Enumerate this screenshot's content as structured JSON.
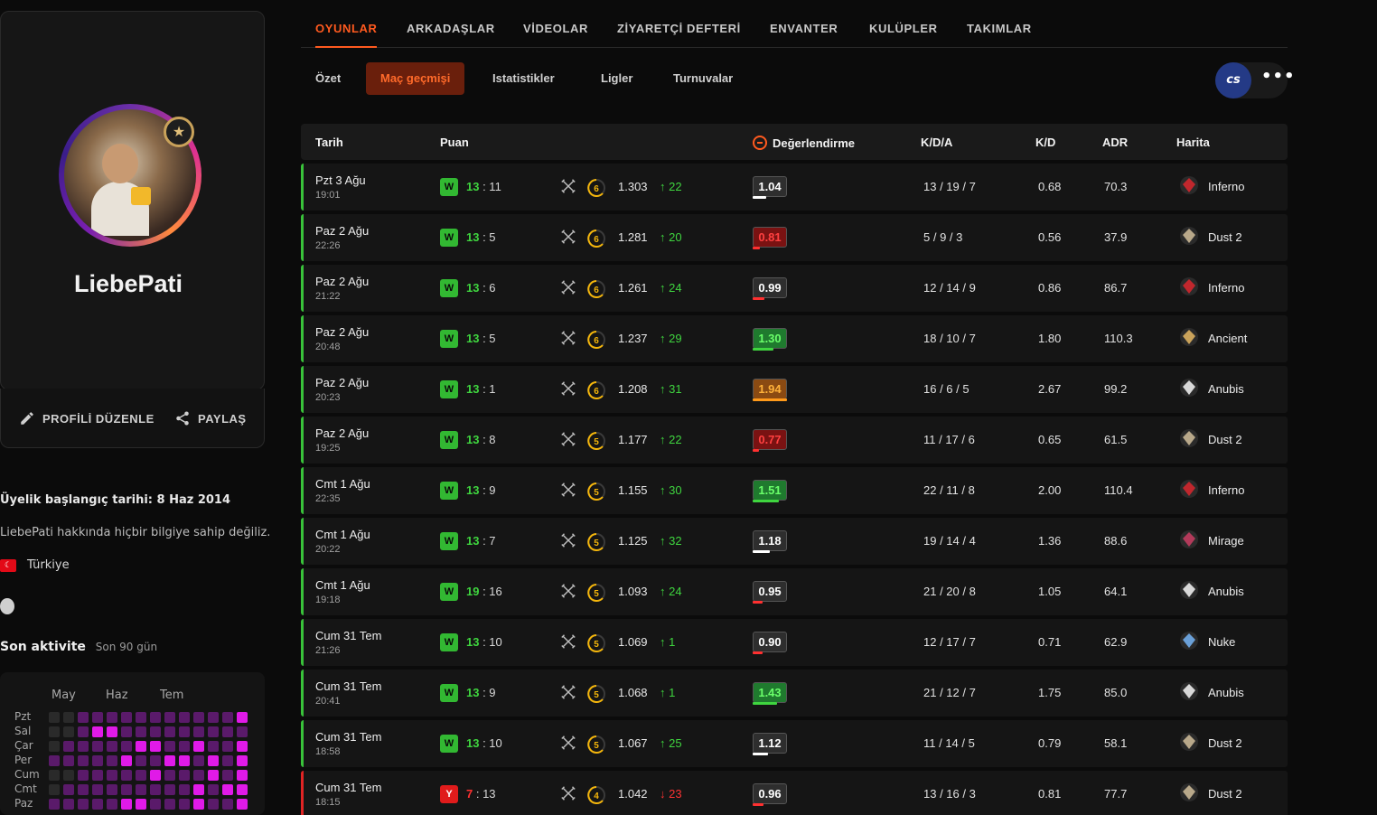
{
  "profile": {
    "username": "LiebePati",
    "edit_label": "PROFİLİ DÜZENLE",
    "share_label": "PAYLAŞ",
    "member_since": "Üyelik başlangıç tarihi: 8 Haz 2014",
    "about": "LiebePati hakkında hiçbir bilgiye sahip değiliz.",
    "country": "Türkiye",
    "activity_title": "Son aktivite",
    "activity_range": "Son 90 gün",
    "months": [
      "May",
      "Haz",
      "Tem"
    ],
    "weekdays": [
      "Pzt",
      "Sal",
      "Çar",
      "Per",
      "Cum",
      "Cmt",
      "Paz"
    ]
  },
  "nav": {
    "tabs": [
      "OYUNLAR",
      "ARKADAŞLAR",
      "VİDEOLAR",
      "ZİYARETÇİ DEFTERİ",
      "ENVANTER",
      "KULÜPLER",
      "TAKIMLAR"
    ],
    "subtabs": [
      "Özet",
      "Maç geçmişi",
      "Istatistikler",
      "Ligler",
      "Turnuvalar"
    ],
    "game_logo": "cs",
    "more_label": "•••"
  },
  "table": {
    "headers": {
      "date": "Tarih",
      "score": "Puan",
      "rating": "Değerlendirme",
      "kda": "K/D/A",
      "kd": "K/D",
      "adr": "ADR",
      "map": "Harita"
    },
    "rows": [
      {
        "date": "Pzt 3 Ağu",
        "time": "19:01",
        "result": "W",
        "my_score": "13",
        "opp_score": "11",
        "level": "6",
        "elo": "1.303",
        "delta": "22",
        "delta_dir": "up",
        "rating": "1.04",
        "rating_fill": 0.4,
        "kda": "13 / 19 / 7",
        "kd": "0.68",
        "adr": "70.3",
        "map": "Inferno"
      },
      {
        "date": "Paz 2 Ağu",
        "time": "22:26",
        "result": "W",
        "my_score": "13",
        "opp_score": "5",
        "level": "6",
        "elo": "1.281",
        "delta": "20",
        "delta_dir": "up",
        "rating": "0.81",
        "rating_fill": 0.2,
        "kda": "5 / 9 / 3",
        "kd": "0.56",
        "adr": "37.9",
        "map": "Dust 2"
      },
      {
        "date": "Paz 2 Ağu",
        "time": "21:22",
        "result": "W",
        "my_score": "13",
        "opp_score": "6",
        "level": "6",
        "elo": "1.261",
        "delta": "24",
        "delta_dir": "up",
        "rating": "0.99",
        "rating_fill": 0.35,
        "kda": "12 / 14 / 9",
        "kd": "0.86",
        "adr": "86.7",
        "map": "Inferno"
      },
      {
        "date": "Paz 2 Ağu",
        "time": "20:48",
        "result": "W",
        "my_score": "13",
        "opp_score": "5",
        "level": "6",
        "elo": "1.237",
        "delta": "29",
        "delta_dir": "up",
        "rating": "1.30",
        "rating_fill": 0.6,
        "kda": "18 / 10 / 7",
        "kd": "1.80",
        "adr": "110.3",
        "map": "Ancient"
      },
      {
        "date": "Paz 2 Ağu",
        "time": "20:23",
        "result": "W",
        "my_score": "13",
        "opp_score": "1",
        "level": "6",
        "elo": "1.208",
        "delta": "31",
        "delta_dir": "up",
        "rating": "1.94",
        "rating_fill": 1.0,
        "kda": "16 / 6 / 5",
        "kd": "2.67",
        "adr": "99.2",
        "map": "Anubis"
      },
      {
        "date": "Paz 2 Ağu",
        "time": "19:25",
        "result": "W",
        "my_score": "13",
        "opp_score": "8",
        "level": "5",
        "elo": "1.177",
        "delta": "22",
        "delta_dir": "up",
        "rating": "0.77",
        "rating_fill": 0.18,
        "kda": "11 / 17 / 6",
        "kd": "0.65",
        "adr": "61.5",
        "map": "Dust 2"
      },
      {
        "date": "Cmt 1 Ağu",
        "time": "22:35",
        "result": "W",
        "my_score": "13",
        "opp_score": "9",
        "level": "5",
        "elo": "1.155",
        "delta": "30",
        "delta_dir": "up",
        "rating": "1.51",
        "rating_fill": 0.75,
        "kda": "22 / 11 / 8",
        "kd": "2.00",
        "adr": "110.4",
        "map": "Inferno"
      },
      {
        "date": "Cmt 1 Ağu",
        "time": "20:22",
        "result": "W",
        "my_score": "13",
        "opp_score": "7",
        "level": "5",
        "elo": "1.125",
        "delta": "32",
        "delta_dir": "up",
        "rating": "1.18",
        "rating_fill": 0.5,
        "kda": "19 / 14 / 4",
        "kd": "1.36",
        "adr": "88.6",
        "map": "Mirage"
      },
      {
        "date": "Cmt 1 Ağu",
        "time": "19:18",
        "result": "W",
        "my_score": "19",
        "opp_score": "16",
        "level": "5",
        "elo": "1.093",
        "delta": "24",
        "delta_dir": "up",
        "rating": "0.95",
        "rating_fill": 0.3,
        "kda": "21 / 20 / 8",
        "kd": "1.05",
        "adr": "64.1",
        "map": "Anubis"
      },
      {
        "date": "Cum 31 Tem",
        "time": "21:26",
        "result": "W",
        "my_score": "13",
        "opp_score": "10",
        "level": "5",
        "elo": "1.069",
        "delta": "1",
        "delta_dir": "up",
        "rating": "0.90",
        "rating_fill": 0.28,
        "kda": "12 / 17 / 7",
        "kd": "0.71",
        "adr": "62.9",
        "map": "Nuke"
      },
      {
        "date": "Cum 31 Tem",
        "time": "20:41",
        "result": "W",
        "my_score": "13",
        "opp_score": "9",
        "level": "5",
        "elo": "1.068",
        "delta": "1",
        "delta_dir": "up",
        "rating": "1.43",
        "rating_fill": 0.7,
        "kda": "21 / 12 / 7",
        "kd": "1.75",
        "adr": "85.0",
        "map": "Anubis"
      },
      {
        "date": "Cum 31 Tem",
        "time": "18:58",
        "result": "W",
        "my_score": "13",
        "opp_score": "10",
        "level": "5",
        "elo": "1.067",
        "delta": "25",
        "delta_dir": "up",
        "rating": "1.12",
        "rating_fill": 0.45,
        "kda": "11 / 14 / 5",
        "kd": "0.79",
        "adr": "58.1",
        "map": "Dust 2"
      },
      {
        "date": "Cum 31 Tem",
        "time": "18:15",
        "result": "Y",
        "my_score": "7",
        "opp_score": "13",
        "level": "4",
        "elo": "1.042",
        "delta": "23",
        "delta_dir": "down",
        "rating": "0.96",
        "rating_fill": 0.32,
        "kda": "13 / 16 / 3",
        "kd": "0.81",
        "adr": "77.7",
        "map": "Dust 2"
      }
    ]
  },
  "colors": {
    "accent": "#ff5a1f",
    "win": "#39c23a",
    "loss": "#e02424",
    "rating_good": "#1f7a2e",
    "rating_bad": "#7a1212",
    "rating_neutral": "#2e2e2e",
    "rating_great": "#8a4a12"
  }
}
